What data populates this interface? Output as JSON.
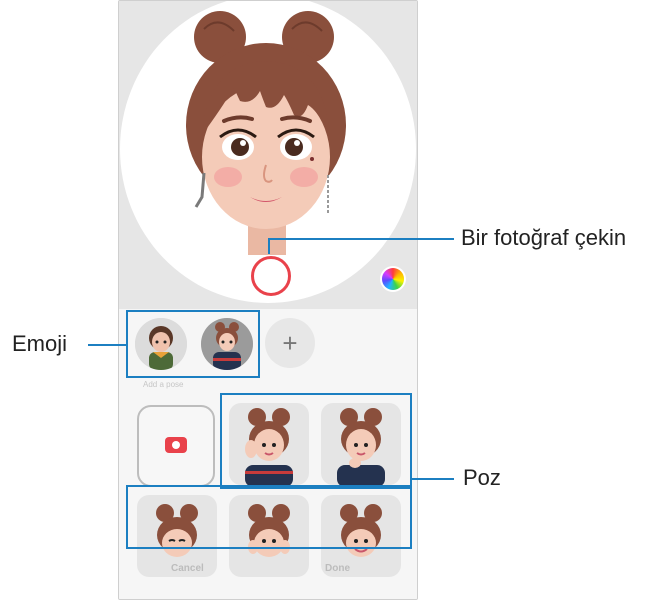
{
  "callouts": {
    "photo": "Bir fotoğraf çekin",
    "emoji": "Emoji",
    "pose": "Poz"
  },
  "screen": {
    "section_label": "Add a pose",
    "add_symbol": "+",
    "footer": {
      "cancel": "Cancel",
      "done": "Done"
    }
  },
  "colors": {
    "accent_red": "#e9424b",
    "annotation_blue": "#1c7fc1",
    "hair_brown": "#8a4f3c",
    "skin": "#f4cbb8"
  },
  "icons": [
    "camera-icon",
    "color-wheel-icon",
    "plus-icon"
  ]
}
